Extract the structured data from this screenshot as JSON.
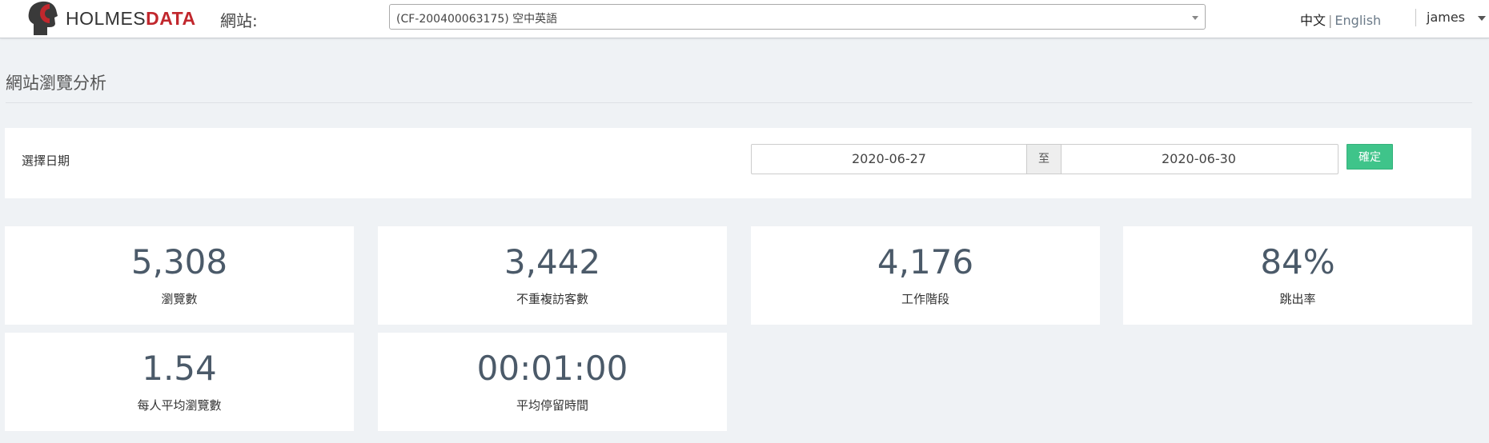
{
  "header": {
    "logo": {
      "prefix": "HOLMES",
      "suffix": "DATA"
    },
    "site_label": "網站:",
    "site_selected": "(CF-200400063175) 空中英語",
    "lang_zh": "中文",
    "lang_sep": "|",
    "lang_en": "English",
    "user": "james"
  },
  "page": {
    "title": "網站瀏覽分析"
  },
  "filter": {
    "label": "選擇日期",
    "date_from": "2020-06-27",
    "date_sep": "至",
    "date_to": "2020-06-30",
    "confirm": "確定"
  },
  "stats": [
    {
      "value": "5,308",
      "label": "瀏覽數"
    },
    {
      "value": "3,442",
      "label": "不重複訪客數"
    },
    {
      "value": "4,176",
      "label": "工作階段"
    },
    {
      "value": "84%",
      "label": "跳出率"
    },
    {
      "value": "1.54",
      "label": "每人平均瀏覽數"
    },
    {
      "value": "00:01:00",
      "label": "平均停留時間"
    }
  ],
  "colors": {
    "brand_red": "#c1272d",
    "confirm_green": "#3fc48a",
    "stat_value": "#4b5a69",
    "page_bg": "#eff2f5"
  }
}
